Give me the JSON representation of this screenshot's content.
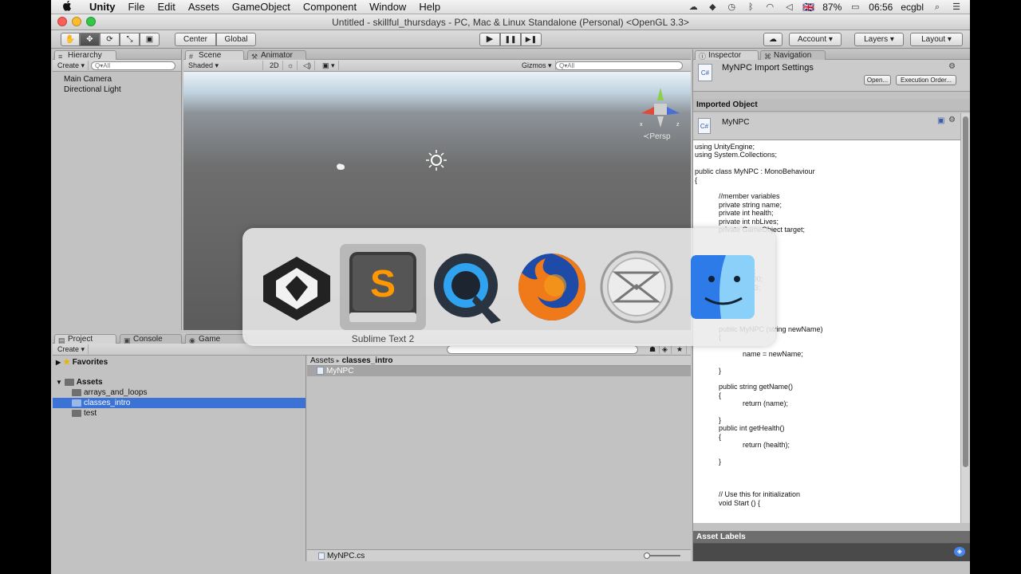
{
  "menubar": {
    "apple": "",
    "items": [
      "Unity",
      "File",
      "Edit",
      "Assets",
      "GameObject",
      "Component",
      "Window",
      "Help"
    ],
    "battery": "87%",
    "flag": "🇬🇧",
    "clock": "06:56",
    "user": "ecgbl"
  },
  "window": {
    "title": "Untitled - skillful_thursdays - PC, Mac & Linux Standalone (Personal) <OpenGL 3.3>"
  },
  "toolbar": {
    "tools": [
      "✋",
      "✥",
      "⟳",
      "⤡",
      "▣"
    ],
    "pivot": "Center",
    "space": "Global",
    "play": "▶",
    "pause": "❚❚",
    "step": "▶❚",
    "cloud": "☁",
    "account": "Account",
    "layers": "Layers",
    "layout": "Layout"
  },
  "hierarchy": {
    "tab": "Hierarchy",
    "create": "Create ▾",
    "search_placeholder": "Q▾All",
    "items": [
      "Main Camera",
      "Directional Light"
    ]
  },
  "scene": {
    "tabs": [
      "Scene",
      "Animator"
    ],
    "shading": "Shaded",
    "mode_2d": "2D",
    "gizmos": "Gizmos ▾",
    "search_placeholder": "Q▾All",
    "persp": "≺Persp"
  },
  "project": {
    "tabs": [
      "Project",
      "Console",
      "Game"
    ],
    "create": "Create ▾",
    "favorites": "Favorites",
    "assets": "Assets",
    "folders": [
      "arrays_and_loops",
      "classes_intro",
      "test"
    ],
    "breadcrumb": [
      "Assets",
      "classes_intro"
    ],
    "breadcrumb_sep": "▸",
    "selected_file": "MyNPC",
    "status_file": "MyNPC.cs"
  },
  "inspector": {
    "tabs": [
      "Inspector",
      "Navigation"
    ],
    "header_title": "MyNPC Import Settings",
    "open_button": "Open...",
    "exec_order_button": "Execution Order...",
    "imported_object_label": "Imported Object",
    "object_name": "MyNPC",
    "asset_labels": "Asset Labels",
    "code": [
      "using UnityEngine;",
      "using System.Collections;",
      "",
      "public class MyNPC : MonoBehaviour",
      "{",
      "",
      "            //member variables",
      "            private string name;",
      "            private int health;",
      "            private int nbLives;",
      "            private GameObject target;",
      "",
      "",
      "",
      "",
      "                        = \"\";",
      "                        = 100;",
      "                        s = 3;",
      "",
      "",
      "",
      "",
      "            public MyNPC (string newName)",
      "            {",
      "",
      "                        name = newName;",
      "",
      "            }",
      "",
      "            public string getName()",
      "            {",
      "                        return (name);",
      "",
      "            }",
      "            public int getHealth()",
      "            {",
      "                        return (health);",
      "",
      "            }",
      "",
      "",
      "",
      "            // Use this for initialization",
      "            void Start () {"
    ]
  },
  "app_switcher": {
    "apps": [
      "Unity",
      "Sublime Text 2",
      "QuickTime Player",
      "Firefox",
      "Mail",
      "Finder"
    ],
    "selected_label": "Sublime Text 2"
  },
  "colors": {
    "selection": "#3a72d6",
    "panel": "#c2c2c2",
    "sublime_orange": "#ff9800"
  }
}
